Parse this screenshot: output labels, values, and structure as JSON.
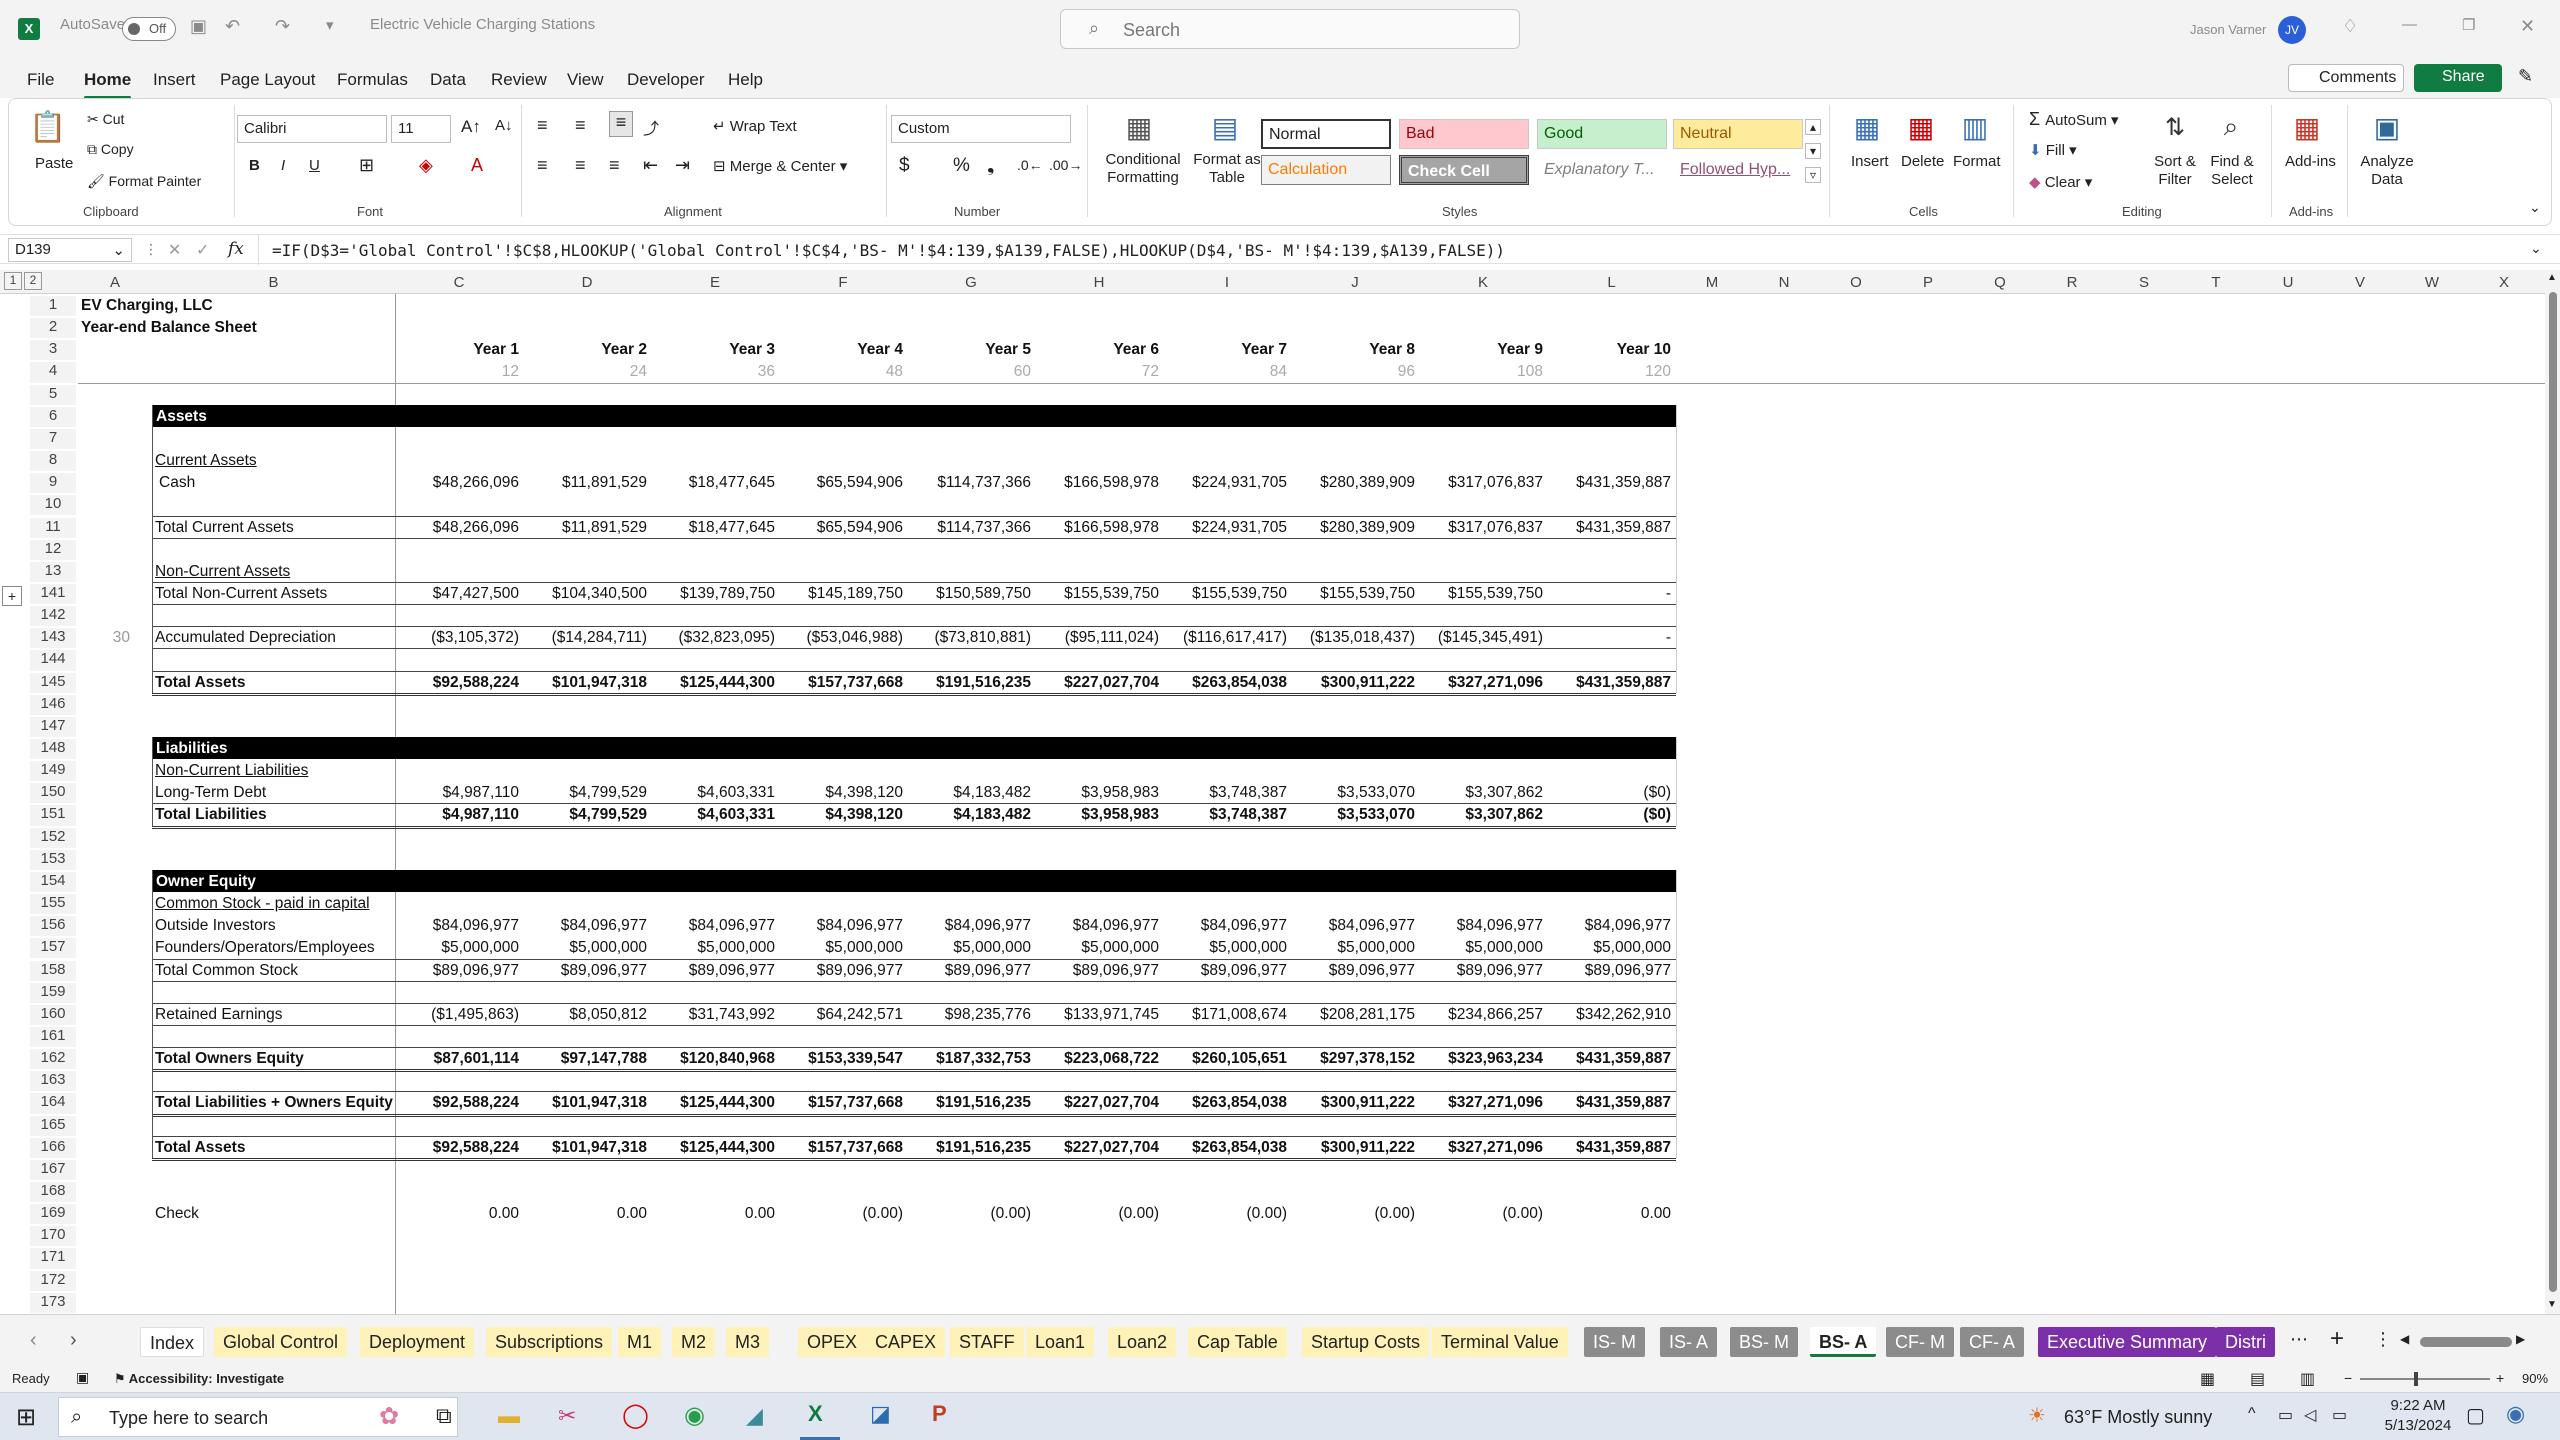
{
  "titlebar": {
    "autosave_label": "AutoSave",
    "autosave_state": "Off",
    "doc_title": "Electric Vehicle Charging Stations",
    "search_placeholder": "Search",
    "user_name": "Jason Varner",
    "user_initials": "JV"
  },
  "menu": [
    "File",
    "Home",
    "Insert",
    "Page Layout",
    "Formulas",
    "Data",
    "Review",
    "View",
    "Developer",
    "Help"
  ],
  "menu_right": {
    "comments": "Comments",
    "share": "Share"
  },
  "ribbon": {
    "clipboard": {
      "paste": "Paste",
      "cut": "Cut",
      "copy": "Copy",
      "format_painter": "Format Painter",
      "group": "Clipboard"
    },
    "font": {
      "name": "Calibri",
      "size": "11",
      "group": "Font"
    },
    "alignment": {
      "wrap": "Wrap Text",
      "merge": "Merge & Center",
      "group": "Alignment"
    },
    "number": {
      "format": "Custom",
      "group": "Number"
    },
    "styles": {
      "cond": "Conditional Formatting",
      "table": "Format as Table",
      "normal": "Normal",
      "bad": "Bad",
      "good": "Good",
      "neutral": "Neutral",
      "calculation": "Calculation",
      "check_cell": "Check Cell",
      "explanatory": "Explanatory T...",
      "followed": "Followed Hyp...",
      "group": "Styles"
    },
    "cells": {
      "insert": "Insert",
      "delete": "Delete",
      "format": "Format",
      "group": "Cells"
    },
    "editing": {
      "autosum": "AutoSum",
      "fill": "Fill",
      "clear": "Clear",
      "sort": "Sort & Filter",
      "find": "Find & Select",
      "group": "Editing"
    },
    "addins": {
      "addins": "Add-ins",
      "analyze": "Analyze Data",
      "group": "Add-ins"
    }
  },
  "formula_bar": {
    "name_box": "D139",
    "fx": "fx",
    "formula": "=IF(D$3='Global Control'!$C$8,HLOOKUP('Global Control'!$C$4,'BS- M'!$4:139,$A139,FALSE),HLOOKUP(D$4,'BS- M'!$4:139,$A139,FALSE))"
  },
  "columns": [
    "A",
    "B",
    "C",
    "D",
    "E",
    "F",
    "G",
    "H",
    "I",
    "J",
    "K",
    "L",
    "M",
    "N",
    "O",
    "P",
    "Q",
    "R",
    "S",
    "T",
    "U",
    "V",
    "W",
    "X"
  ],
  "rows": [
    "1",
    "2",
    "3",
    "4",
    "5",
    "6",
    "7",
    "8",
    "9",
    "10",
    "11",
    "12",
    "13",
    "141",
    "142",
    "143",
    "144",
    "145",
    "146",
    "147",
    "148",
    "149",
    "150",
    "151",
    "152",
    "153",
    "154",
    "155",
    "156",
    "157",
    "158",
    "159",
    "160",
    "161",
    "162",
    "163",
    "164",
    "165",
    "166",
    "167",
    "168",
    "169",
    "170",
    "171",
    "172",
    "173"
  ],
  "sheet": {
    "company": "EV Charging, LLC",
    "report": "Year-end Balance Sheet",
    "a143": "30",
    "years": [
      "Year 1",
      "Year 2",
      "Year 3",
      "Year 4",
      "Year 5",
      "Year 6",
      "Year 7",
      "Year 8",
      "Year 9",
      "Year 10"
    ],
    "months": [
      "12",
      "24",
      "36",
      "48",
      "60",
      "72",
      "84",
      "96",
      "108",
      "120"
    ],
    "labels": {
      "assets": "Assets",
      "current_assets": "Current Assets",
      "cash": "Cash",
      "total_current": "Total Current Assets",
      "non_current": "Non-Current Assets",
      "total_non_current": "Total Non-Current Assets",
      "accum_dep": "Accumulated Depreciation",
      "total_assets": "Total Assets",
      "liabilities": "Liabilities",
      "nc_liabilities": "Non-Current Liabilities",
      "ltd": "Long-Term Debt",
      "total_liabilities": "Total Liabilities",
      "owner_equity": "Owner Equity",
      "common_stock": "Common Stock - paid in capital",
      "outside": "Outside Investors",
      "founders": "Founders/Operators/Employees",
      "total_common": "Total Common Stock",
      "retained": "Retained Earnings",
      "total_owners": "Total Owners Equity",
      "total_liab_owners": "Total Liabilities + Owners Equity",
      "total_assets2": "Total Assets",
      "check": "Check"
    },
    "values": {
      "cash": [
        "$48,266,096",
        "$11,891,529",
        "$18,477,645",
        "$65,594,906",
        "$114,737,366",
        "$166,598,978",
        "$224,931,705",
        "$280,389,909",
        "$317,076,837",
        "$431,359,887"
      ],
      "total_current": [
        "$48,266,096",
        "$11,891,529",
        "$18,477,645",
        "$65,594,906",
        "$114,737,366",
        "$166,598,978",
        "$224,931,705",
        "$280,389,909",
        "$317,076,837",
        "$431,359,887"
      ],
      "total_non_current": [
        "$47,427,500",
        "$104,340,500",
        "$139,789,750",
        "$145,189,750",
        "$150,589,750",
        "$155,539,750",
        "$155,539,750",
        "$155,539,750",
        "$155,539,750",
        "-"
      ],
      "accum_dep": [
        "($3,105,372)",
        "($14,284,711)",
        "($32,823,095)",
        "($53,046,988)",
        "($73,810,881)",
        "($95,111,024)",
        "($116,617,417)",
        "($135,018,437)",
        "($145,345,491)",
        "-"
      ],
      "total_assets": [
        "$92,588,224",
        "$101,947,318",
        "$125,444,300",
        "$157,737,668",
        "$191,516,235",
        "$227,027,704",
        "$263,854,038",
        "$300,911,222",
        "$327,271,096",
        "$431,359,887"
      ],
      "ltd": [
        "$4,987,110",
        "$4,799,529",
        "$4,603,331",
        "$4,398,120",
        "$4,183,482",
        "$3,958,983",
        "$3,748,387",
        "$3,533,070",
        "$3,307,862",
        "($0)"
      ],
      "total_liabilities": [
        "$4,987,110",
        "$4,799,529",
        "$4,603,331",
        "$4,398,120",
        "$4,183,482",
        "$3,958,983",
        "$3,748,387",
        "$3,533,070",
        "$3,307,862",
        "($0)"
      ],
      "outside": [
        "$84,096,977",
        "$84,096,977",
        "$84,096,977",
        "$84,096,977",
        "$84,096,977",
        "$84,096,977",
        "$84,096,977",
        "$84,096,977",
        "$84,096,977",
        "$84,096,977"
      ],
      "founders": [
        "$5,000,000",
        "$5,000,000",
        "$5,000,000",
        "$5,000,000",
        "$5,000,000",
        "$5,000,000",
        "$5,000,000",
        "$5,000,000",
        "$5,000,000",
        "$5,000,000"
      ],
      "total_common": [
        "$89,096,977",
        "$89,096,977",
        "$89,096,977",
        "$89,096,977",
        "$89,096,977",
        "$89,096,977",
        "$89,096,977",
        "$89,096,977",
        "$89,096,977",
        "$89,096,977"
      ],
      "retained": [
        "($1,495,863)",
        "$8,050,812",
        "$31,743,992",
        "$64,242,571",
        "$98,235,776",
        "$133,971,745",
        "$171,008,674",
        "$208,281,175",
        "$234,866,257",
        "$342,262,910"
      ],
      "total_owners": [
        "$87,601,114",
        "$97,147,788",
        "$120,840,968",
        "$153,339,547",
        "$187,332,753",
        "$223,068,722",
        "$260,105,651",
        "$297,378,152",
        "$323,963,234",
        "$431,359,887"
      ],
      "total_liab_owners": [
        "$92,588,224",
        "$101,947,318",
        "$125,444,300",
        "$157,737,668",
        "$191,516,235",
        "$227,027,704",
        "$263,854,038",
        "$300,911,222",
        "$327,271,096",
        "$431,359,887"
      ],
      "total_assets2": [
        "$92,588,224",
        "$101,947,318",
        "$125,444,300",
        "$157,737,668",
        "$191,516,235",
        "$227,027,704",
        "$263,854,038",
        "$300,911,222",
        "$327,271,096",
        "$431,359,887"
      ],
      "check": [
        "0.00",
        "0.00",
        "0.00",
        "(0.00)",
        "(0.00)",
        "(0.00)",
        "(0.00)",
        "(0.00)",
        "(0.00)",
        "0.00"
      ]
    }
  },
  "tabs": [
    {
      "label": "Index",
      "color": "#ffffff"
    },
    {
      "label": "Global Control",
      "color": "#fff2b8"
    },
    {
      "label": "Deployment",
      "color": "#fff2b8"
    },
    {
      "label": "Subscriptions",
      "color": "#fff2b8"
    },
    {
      "label": "M1",
      "color": "#fff2b8"
    },
    {
      "label": "M2",
      "color": "#fff2b8"
    },
    {
      "label": "M3",
      "color": "#fff2b8"
    },
    {
      "label": "OPEX",
      "color": "#fff2b8"
    },
    {
      "label": "CAPEX",
      "color": "#fff2b8"
    },
    {
      "label": "STAFF",
      "color": "#fff2b8"
    },
    {
      "label": "Loan1",
      "color": "#fff2b8"
    },
    {
      "label": "Loan2",
      "color": "#fff2b8"
    },
    {
      "label": "Cap Table",
      "color": "#fff2b8"
    },
    {
      "label": "Startup Costs",
      "color": "#fff2b8"
    },
    {
      "label": "Terminal Value",
      "color": "#fff2b8"
    },
    {
      "label": "IS- M",
      "color": "#8c8c8c"
    },
    {
      "label": "IS- A",
      "color": "#8c8c8c"
    },
    {
      "label": "BS- M",
      "color": "#8c8c8c"
    },
    {
      "label": "BS- A",
      "color": "#ffffff"
    },
    {
      "label": "CF- M",
      "color": "#8c8c8c"
    },
    {
      "label": "CF- A",
      "color": "#8c8c8c"
    },
    {
      "label": "Executive Summary",
      "color": "#7b2fa8"
    },
    {
      "label": "Distri",
      "color": "#7b2fa8"
    }
  ],
  "status": {
    "ready": "Ready",
    "accessibility": "Accessibility: Investigate",
    "zoom": "90%"
  },
  "taskbar": {
    "search": "Type here to search",
    "weather": "63°F  Mostly sunny",
    "time": "9:22 AM",
    "date": "5/13/2024"
  }
}
